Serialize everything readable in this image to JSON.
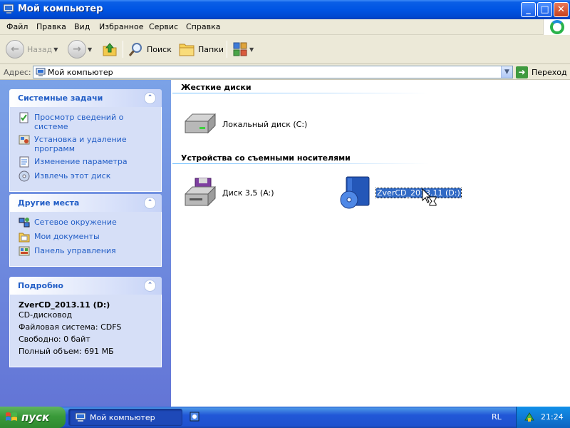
{
  "window": {
    "title": "Мой компьютер",
    "controls": {
      "minimize": "_",
      "maximize": "□",
      "close": "✕"
    }
  },
  "menu": [
    "Файл",
    "Правка",
    "Вид",
    "Избранное",
    "Сервис",
    "Справка"
  ],
  "toolbar": {
    "back_label": "Назад",
    "search_label": "Поиск",
    "folders_label": "Папки"
  },
  "address": {
    "label": "Адрес:",
    "value": "Мой компьютер",
    "go_label": "Переход"
  },
  "sidebar": {
    "system_tasks": {
      "title": "Системные задачи",
      "items": [
        {
          "label": "Просмотр сведений о системе",
          "icon": "system-info-icon"
        },
        {
          "label": "Установка и удаление программ",
          "icon": "add-remove-programs-icon"
        },
        {
          "label": "Изменение параметра",
          "icon": "control-panel-setting-icon"
        },
        {
          "label": "Извлечь этот диск",
          "icon": "eject-disk-icon"
        }
      ]
    },
    "other_places": {
      "title": "Другие места",
      "items": [
        {
          "label": "Сетевое окружение",
          "icon": "network-places-icon"
        },
        {
          "label": "Мои документы",
          "icon": "my-documents-icon"
        },
        {
          "label": "Панель управления",
          "icon": "control-panel-icon"
        }
      ]
    },
    "details": {
      "title": "Подробно",
      "name": "ZverCD_2013.11 (D:)",
      "type": "CD-дисковод",
      "filesystem": "Файловая система: CDFS",
      "free": "Свободно: 0 байт",
      "total": "Полный объем: 691 МБ"
    }
  },
  "content": {
    "groups": [
      {
        "title": "Жесткие диски",
        "items": [
          {
            "label": "Локальный диск (C:)",
            "icon": "hard-drive-icon"
          }
        ]
      },
      {
        "title": "Устройства со съемными носителями",
        "items": [
          {
            "label": "Диск 3,5 (A:)",
            "icon": "floppy-drive-icon"
          },
          {
            "label": "ZverCD_2013.11 (D:)",
            "icon": "cd-drive-icon",
            "selected": true
          }
        ]
      }
    ]
  },
  "taskbar": {
    "start_label": "пуск",
    "task_label": "Мой компьютер",
    "language": "RL",
    "clock": "21:24"
  },
  "colors": {
    "titlebar": "#0054e3",
    "taskpane": "#7ba2e7",
    "link": "#215dc6",
    "selection": "#316ac5",
    "start": "#3a9a3a"
  }
}
